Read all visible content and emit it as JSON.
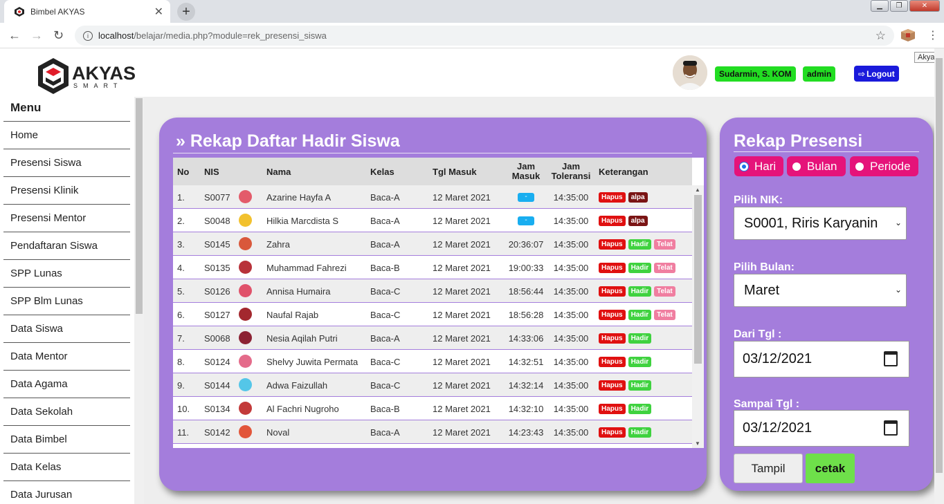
{
  "browser": {
    "tab_title": "Bimbel AKYAS",
    "tab_close": "✕",
    "new_tab": "+",
    "url_host": "localhost",
    "url_path": "/belajar/media.php?module=rek_presensi_siswa",
    "tooltip": "Akyas"
  },
  "header": {
    "logo_text": "AKYAS",
    "logo_sub": "S M A R T",
    "user_name": "Sudarmin, S. KOM",
    "user_role": "admin",
    "logout_label": "Logout"
  },
  "sidebar": {
    "title": "Menu",
    "items": [
      {
        "label": "Home"
      },
      {
        "label": "Presensi Siswa"
      },
      {
        "label": "Presensi Klinik"
      },
      {
        "label": "Presensi Mentor"
      },
      {
        "label": "Pendaftaran Siswa"
      },
      {
        "label": "SPP Lunas"
      },
      {
        "label": "SPP Blm Lunas"
      },
      {
        "label": "Data Siswa"
      },
      {
        "label": "Data Mentor"
      },
      {
        "label": "Data Agama"
      },
      {
        "label": "Data Sekolah"
      },
      {
        "label": "Data Bimbel"
      },
      {
        "label": "Data Kelas"
      },
      {
        "label": "Data Jurusan"
      }
    ]
  },
  "rekap": {
    "title": "» Rekap Daftar Hadir Siswa",
    "columns": {
      "no": "No",
      "nis": "NIS",
      "nama": "Nama",
      "kelas": "Kelas",
      "tgl": "Tgl Masuk",
      "jam_masuk": "Jam Masuk",
      "jam_toleransi": "Jam Toleransi",
      "keterangan": "Keterangan"
    },
    "rows": [
      {
        "no": "1.",
        "nis": "S0077",
        "nama": "Azarine Hayfa A",
        "kelas": "Baca-A",
        "tgl": "12 Maret 2021",
        "jam_masuk": "-",
        "jam_toleransi": "14:35:00",
        "badges": [
          "Hapus",
          "alpa"
        ],
        "avatar_color": "#e35b6a"
      },
      {
        "no": "2.",
        "nis": "S0048",
        "nama": "Hilkia Marcdista S",
        "kelas": "Baca-A",
        "tgl": "12 Maret 2021",
        "jam_masuk": "-",
        "jam_toleransi": "14:35:00",
        "badges": [
          "Hapus",
          "alpa"
        ],
        "avatar_color": "#f2c12e"
      },
      {
        "no": "3.",
        "nis": "S0145",
        "nama": "Zahra",
        "kelas": "Baca-A",
        "tgl": "12 Maret 2021",
        "jam_masuk": "20:36:07",
        "jam_toleransi": "14:35:00",
        "badges": [
          "Hapus",
          "Hadir",
          "Telat"
        ],
        "avatar_color": "#d9583b"
      },
      {
        "no": "4.",
        "nis": "S0135",
        "nama": "Muhammad Fahrezi",
        "kelas": "Baca-B",
        "tgl": "12 Maret 2021",
        "jam_masuk": "19:00:33",
        "jam_toleransi": "14:35:00",
        "badges": [
          "Hapus",
          "Hadir",
          "Telat"
        ],
        "avatar_color": "#b8323a"
      },
      {
        "no": "5.",
        "nis": "S0126",
        "nama": "Annisa Humaira",
        "kelas": "Baca-C",
        "tgl": "12 Maret 2021",
        "jam_masuk": "18:56:44",
        "jam_toleransi": "14:35:00",
        "badges": [
          "Hapus",
          "Hadir",
          "Telat"
        ],
        "avatar_color": "#e0526a"
      },
      {
        "no": "6.",
        "nis": "S0127",
        "nama": "Naufal Rajab",
        "kelas": "Baca-C",
        "tgl": "12 Maret 2021",
        "jam_masuk": "18:56:28",
        "jam_toleransi": "14:35:00",
        "badges": [
          "Hapus",
          "Hadir",
          "Telat"
        ],
        "avatar_color": "#a3282e"
      },
      {
        "no": "7.",
        "nis": "S0068",
        "nama": "Nesia Aqilah Putri",
        "kelas": "Baca-A",
        "tgl": "12 Maret 2021",
        "jam_masuk": "14:33:06",
        "jam_toleransi": "14:35:00",
        "badges": [
          "Hapus",
          "Hadir"
        ],
        "avatar_color": "#8c2233"
      },
      {
        "no": "8.",
        "nis": "S0124",
        "nama": "Shelvy Juwita Permata",
        "kelas": "Baca-C",
        "tgl": "12 Maret 2021",
        "jam_masuk": "14:32:51",
        "jam_toleransi": "14:35:00",
        "badges": [
          "Hapus",
          "Hadir"
        ],
        "avatar_color": "#e46b8a"
      },
      {
        "no": "9.",
        "nis": "S0144",
        "nama": "Adwa Faizullah",
        "kelas": "Baca-C",
        "tgl": "12 Maret 2021",
        "jam_masuk": "14:32:14",
        "jam_toleransi": "14:35:00",
        "badges": [
          "Hapus",
          "Hadir"
        ],
        "avatar_color": "#54c6e8"
      },
      {
        "no": "10.",
        "nis": "S0134",
        "nama": "Al Fachri Nugroho",
        "kelas": "Baca-B",
        "tgl": "12 Maret 2021",
        "jam_masuk": "14:32:10",
        "jam_toleransi": "14:35:00",
        "badges": [
          "Hapus",
          "Hadir"
        ],
        "avatar_color": "#c33a3a"
      },
      {
        "no": "11.",
        "nis": "S0142",
        "nama": "Noval",
        "kelas": "Baca-A",
        "tgl": "12 Maret 2021",
        "jam_masuk": "14:23:43",
        "jam_toleransi": "14:35:00",
        "badges": [
          "Hapus",
          "Hadir"
        ],
        "avatar_color": "#e2563a"
      }
    ]
  },
  "presensi": {
    "title": "Rekap Presensi",
    "radios": [
      {
        "label": "Hari",
        "checked": true
      },
      {
        "label": "Bulan",
        "checked": false
      },
      {
        "label": "Periode",
        "checked": false
      }
    ],
    "nik_label": "Pilih NIK:",
    "nik_value": "S0001, Riris Karyanin",
    "bulan_label": "Pilih Bulan:",
    "bulan_value": "Maret",
    "dari_label": "Dari Tgl :",
    "dari_value": "03/12/2021",
    "sampai_label": "Sampai Tgl :",
    "sampai_value": "03/12/2021",
    "tampil_label": "Tampil",
    "cetak_label": "cetak"
  },
  "colors": {
    "panel": "#a47ddc",
    "radio_pill": "#e5137a",
    "user_pill": "#22dd22",
    "logout": "#1a1adb"
  }
}
